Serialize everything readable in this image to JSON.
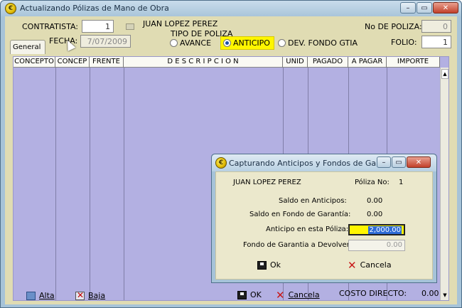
{
  "main_window": {
    "title": "Actualizando Pólizas de Mano de Obra",
    "controls": {
      "minimize": "–",
      "maximize": "▭",
      "close": "✕"
    }
  },
  "header": {
    "contratista_label": "CONTRATISTA:",
    "contratista_value": "1",
    "contratista_name": "JUAN LOPEZ PEREZ",
    "fecha_label": "FECHA:",
    "fecha_value": "7/07/2009",
    "tipo_poliza_label": "TIPO DE POLIZA",
    "radio_options": [
      {
        "label": "AVANCE",
        "selected": false
      },
      {
        "label": "ANTICIPO",
        "selected": true
      },
      {
        "label": "DEV. FONDO GTIA",
        "selected": false
      }
    ],
    "no_poliza_label": "No DE POLIZA:",
    "no_poliza_value": "0",
    "folio_label": "FOLIO:",
    "folio_value": "1"
  },
  "tab": {
    "label": "General"
  },
  "grid": {
    "columns": [
      "CONCEPTO",
      "CONCEP",
      "FRENTE",
      "D E S C R I P C I O N",
      "UNID",
      "PAGADO",
      "A PAGAR",
      "IMPORTE"
    ]
  },
  "footer": {
    "alta_label": "Alta",
    "baja_label": "Baja",
    "ok_label": "OK",
    "cancela_label": "Cancela",
    "costo_directo_label": "COSTO DIRECTO:",
    "costo_directo_value": "0.00"
  },
  "dialog": {
    "title": "Capturando Anticipos y Fondos de Garan...",
    "contratista_name": "JUAN LOPEZ PEREZ",
    "poliza_label": "Póliza No:",
    "poliza_value": "1",
    "saldo_anticipos_label": "Saldo en Anticipos:",
    "saldo_anticipos_value": "0.00",
    "saldo_fondo_label": "Saldo en Fondo de Garantía:",
    "saldo_fondo_value": "0.00",
    "anticipo_label": "Anticipo en esta Póliza:",
    "anticipo_value": "2,000.00",
    "fondo_devolver_label": "Fondo de Garantia a Devolver:",
    "fondo_devolver_value": "0.00",
    "ok_label": "Ok",
    "cancela_label": "Cancela"
  },
  "colors": {
    "grid_bg": "#b3b0e2",
    "form_bg": "#e0dcb3",
    "highlight": "#fff600",
    "chrome": "#a6c3d8"
  },
  "icons": [
    "app-logo-icon",
    "lookup-icon",
    "cursor-icon",
    "add-icon",
    "delete-icon",
    "save-icon",
    "cancel-x-icon"
  ]
}
